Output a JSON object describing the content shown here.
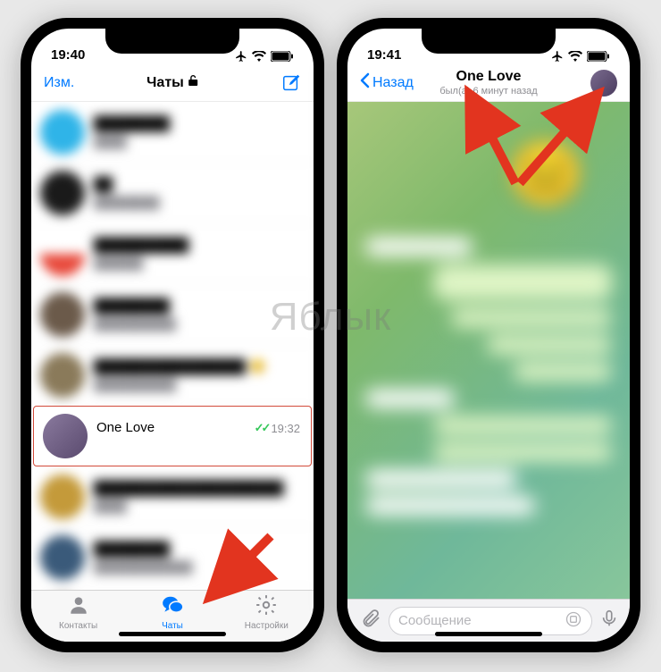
{
  "watermark": "Яблык",
  "left_phone": {
    "status": {
      "time": "19:40"
    },
    "nav": {
      "edit_label": "Изм.",
      "title": "Чаты"
    },
    "highlighted_chat": {
      "name": "One Love",
      "time": "19:32",
      "read_checks": "✓✓"
    },
    "tabs": {
      "contacts": "Контакты",
      "chats": "Чаты",
      "settings": "Настройки"
    }
  },
  "right_phone": {
    "status": {
      "time": "19:41"
    },
    "nav": {
      "back_label": "Назад",
      "title": "One Love",
      "subtitle": "был(а) 6 минут назад"
    },
    "compose": {
      "placeholder": "Сообщение"
    }
  },
  "colors": {
    "accent": "#007aff",
    "highlight_border": "#d24a3a",
    "arrow": "#e2341f"
  }
}
